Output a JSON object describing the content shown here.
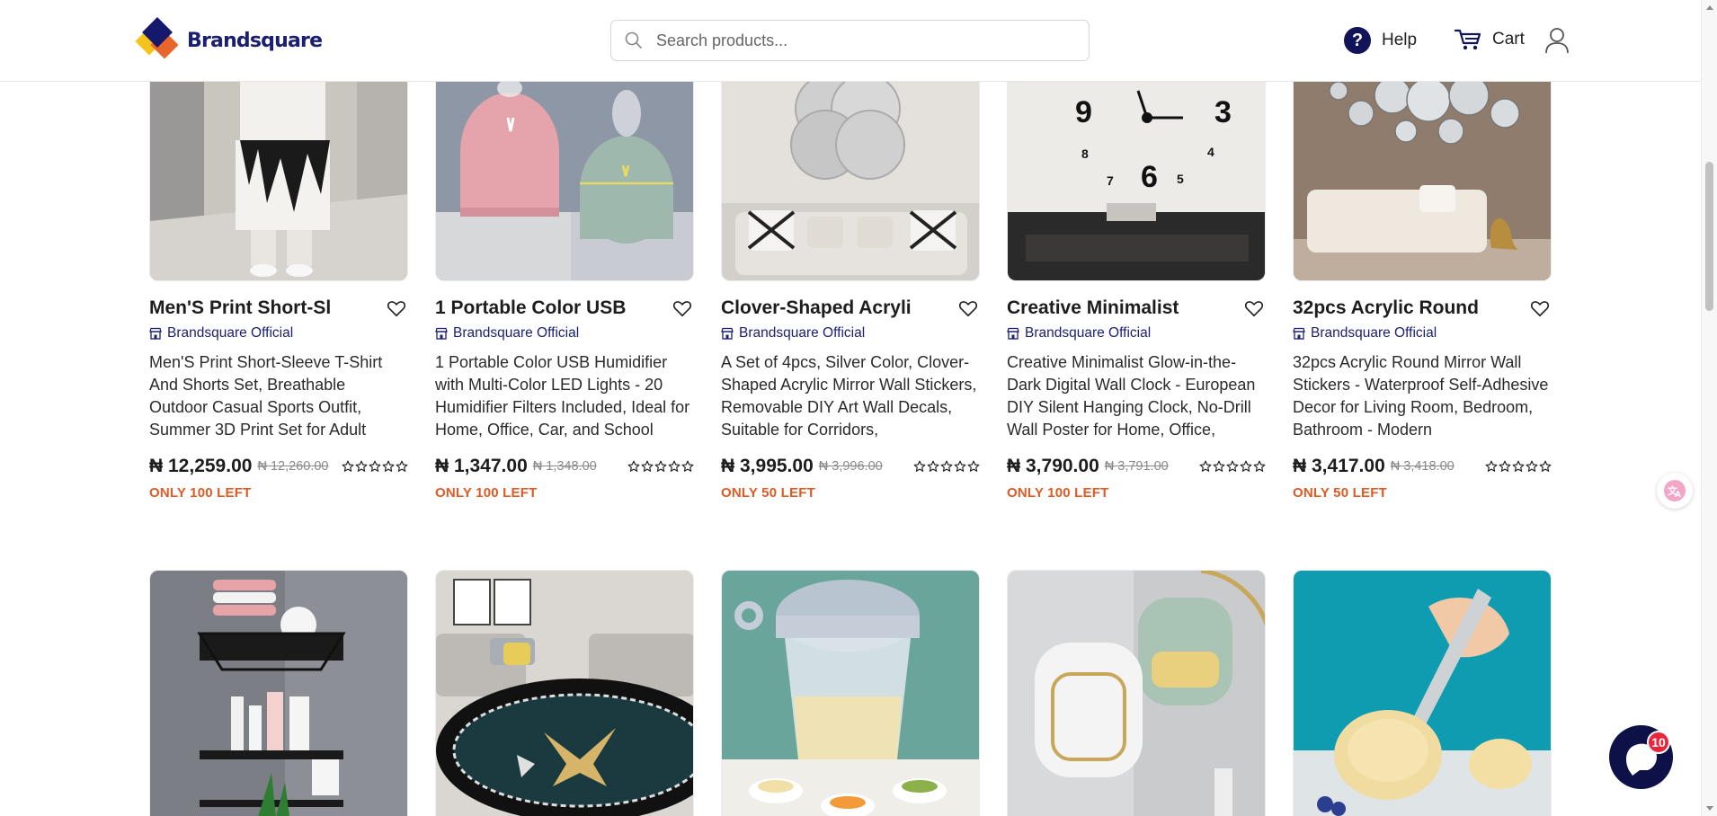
{
  "header": {
    "brand": "Brandsquare",
    "search_placeholder": "Search products...",
    "help_label": "Help",
    "cart_label": "Cart"
  },
  "colors": {
    "brand_navy": "#1a1f71",
    "stock_orange": "#e05a24",
    "chat_navy": "#0d1147",
    "badge_red": "#e8253b"
  },
  "products_row1": [
    {
      "title": "Men'S Print Short-Sl",
      "store": "Brandsquare Official",
      "description": "Men'S Print Short-Sleeve T-Shirt And Shorts Set, Breathable Outdoor Casual Sports Outfit, Summer 3D Print Set for Adult",
      "price": "₦ 12,259.00",
      "old_price": "₦ 12,260.00",
      "stock": "ONLY 100 LEFT",
      "rating": 0,
      "image": "man-outfit-photo"
    },
    {
      "title": "1 Portable Color USB",
      "store": "Brandsquare Official",
      "description": "1 Portable Color USB Humidifier with Multi-Color LED Lights - 20 Humidifier Filters Included, Ideal for Home, Office, Car, and School",
      "price": "₦ 1,347.00",
      "old_price": "₦ 1,348.00",
      "stock": "ONLY 100 LEFT",
      "rating": 0,
      "image": "humidifier-photo"
    },
    {
      "title": "Clover-Shaped Acryli",
      "store": "Brandsquare Official",
      "description": "A Set of 4pcs, Silver Color, Clover-Shaped Acrylic Mirror Wall Stickers, Removable DIY Art Wall Decals, Suitable for Corridors,",
      "price": "₦ 3,995.00",
      "old_price": "₦ 3,996.00",
      "stock": "ONLY 50 LEFT",
      "rating": 0,
      "image": "mirror-stickers-photo"
    },
    {
      "title": "Creative Minimalist",
      "store": "Brandsquare Official",
      "description": "Creative Minimalist Glow-in-the-Dark Digital Wall Clock - European DIY Silent Hanging Clock, No-Drill Wall Poster for Home, Office,",
      "price": "₦ 3,790.00",
      "old_price": "₦ 3,791.00",
      "stock": "ONLY 100 LEFT",
      "rating": 0,
      "image": "wall-clock-photo"
    },
    {
      "title": "32pcs Acrylic Round",
      "store": "Brandsquare Official",
      "description": "32pcs Acrylic Round Mirror Wall Stickers - Waterproof Self-Adhesive Decor for Living Room, Bedroom, Bathroom - Modern",
      "price": "₦ 3,417.00",
      "old_price": "₦ 3,418.00",
      "stock": "ONLY 50 LEFT",
      "rating": 0,
      "image": "round-mirrors-photo"
    }
  ],
  "products_row2": [
    {
      "image": "bathroom-shelf-photo"
    },
    {
      "image": "butterfly-rug-photo"
    },
    {
      "image": "food-chopper-photo"
    },
    {
      "image": "soap-dish-photo"
    },
    {
      "image": "ice-cream-scoop-photo"
    }
  ],
  "chat": {
    "badge_count": "10"
  },
  "icons": [
    "search-icon",
    "help-icon",
    "cart-icon",
    "user-icon",
    "heart-icon",
    "store-icon",
    "star-icon",
    "translate-icon",
    "chat-icon"
  ]
}
